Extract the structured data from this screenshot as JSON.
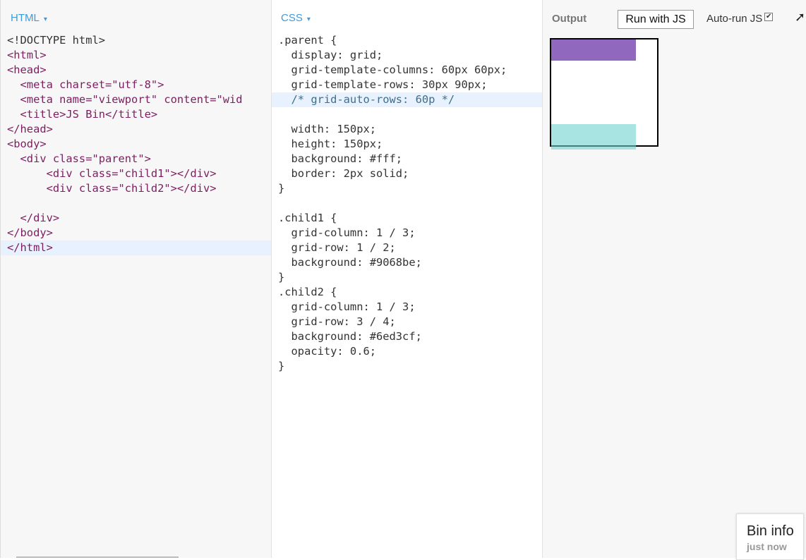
{
  "html_panel": {
    "label": "HTML",
    "caret": "▾",
    "lines": [
      {
        "text": "<!DOCTYPE html>"
      },
      {
        "text": "<html>"
      },
      {
        "text": "<head>"
      },
      {
        "text": "  <meta charset=\"utf-8\">"
      },
      {
        "text": "  <meta name=\"viewport\" content=\"wid"
      },
      {
        "text": "  <title>JS Bin</title>"
      },
      {
        "text": "</head>"
      },
      {
        "text": "<body>"
      },
      {
        "text": "  <div class=\"parent\">"
      },
      {
        "text": "      <div class=\"child1\"></div>"
      },
      {
        "text": "      <div class=\"child2\"></div>"
      },
      {
        "text": ""
      },
      {
        "text": "  </div>"
      },
      {
        "text": "</body>"
      },
      {
        "text": "</html>"
      }
    ]
  },
  "css_panel": {
    "label": "CSS",
    "caret": "▾",
    "lines": [
      {
        "text": ".parent {"
      },
      {
        "text": "  display: grid;"
      },
      {
        "text": "  grid-template-columns: 60px 60px;"
      },
      {
        "text": "  grid-template-rows: 30px 90px;"
      },
      {
        "text": "  /* grid-auto-rows: 60p */"
      },
      {
        "text": ""
      },
      {
        "text": "  width: 150px;"
      },
      {
        "text": "  height: 150px;"
      },
      {
        "text": "  background: #fff;"
      },
      {
        "text": "  border: 2px solid;"
      },
      {
        "text": "}"
      },
      {
        "text": ""
      },
      {
        "text": ".child1 {"
      },
      {
        "text": "  grid-column: 1 / 3;"
      },
      {
        "text": "  grid-row: 1 / 2;"
      },
      {
        "text": "  background: #9068be;"
      },
      {
        "text": "}"
      },
      {
        "text": ".child2 {"
      },
      {
        "text": "  grid-column: 1 / 3;"
      },
      {
        "text": "  grid-row: 3 / 4;"
      },
      {
        "text": "  background: #6ed3cf;"
      },
      {
        "text": "  opacity: 0.6;"
      },
      {
        "text": "}"
      }
    ]
  },
  "output_panel": {
    "label": "Output",
    "run_button": "Run with JS",
    "autorun_label": "Auto-run JS",
    "autorun_check": "✔",
    "expand_icon": "➚",
    "child1_color": "#9068be",
    "child2_color": "#6ed3cf"
  },
  "bin_info": {
    "title": "Bin info",
    "subtitle": "just now"
  }
}
